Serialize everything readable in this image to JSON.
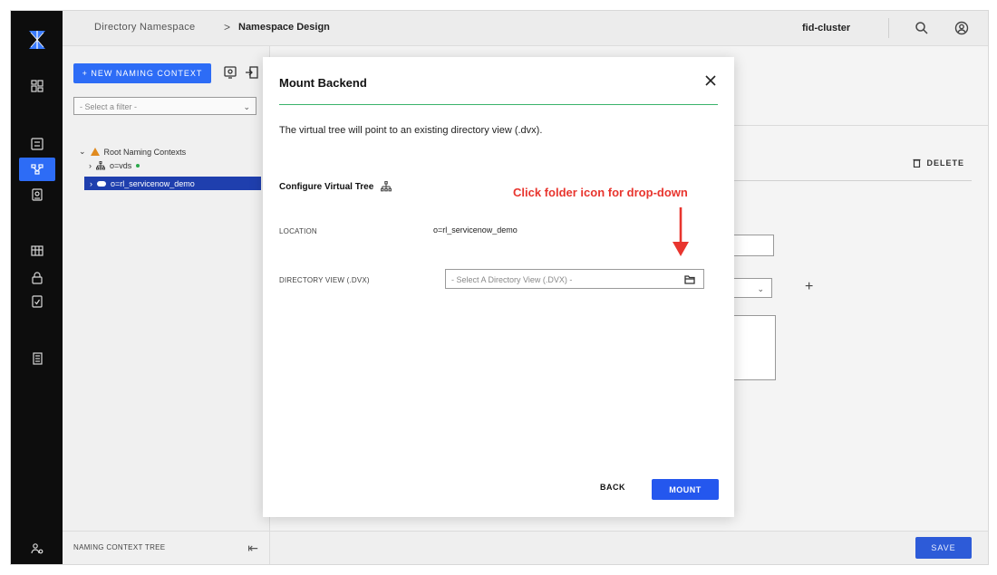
{
  "topbar": {
    "breadcrumb_root": "Directory Namespace",
    "breadcrumb_sep": ">",
    "breadcrumb_current": "Namespace Design",
    "cluster": "fid-cluster"
  },
  "tree_panel": {
    "new_button": "+ NEW NAMING CONTEXT",
    "filter_placeholder": "- Select a filter -",
    "tree": {
      "root": "Root Naming Contexts",
      "child1": "o=vds",
      "child2": "o=rl_servicenow_demo"
    },
    "footer_label": "NAMING CONTEXT TREE"
  },
  "right": {
    "delete_label": "DELETE",
    "plus": "+",
    "save_label": "SAVE"
  },
  "modal": {
    "title": "Mount Backend",
    "description": "The virtual tree will point to an existing directory view (.dvx).",
    "section_title": "Configure Virtual Tree",
    "annotation": "Click folder icon for drop-down",
    "location_label": "LOCATION",
    "location_value": "o=rl_servicenow_demo",
    "dvx_label": "DIRECTORY VIEW (.DVX)",
    "dvx_placeholder": "- Select A Directory View (.DVX) -",
    "back_label": "BACK",
    "mount_label": "MOUNT"
  },
  "colors": {
    "accent": "#2d6cf6",
    "annotation": "#e8352e",
    "divider_green": "#3ab36b",
    "selected_row": "#1f3fae",
    "rail": "#0d0d0d"
  }
}
